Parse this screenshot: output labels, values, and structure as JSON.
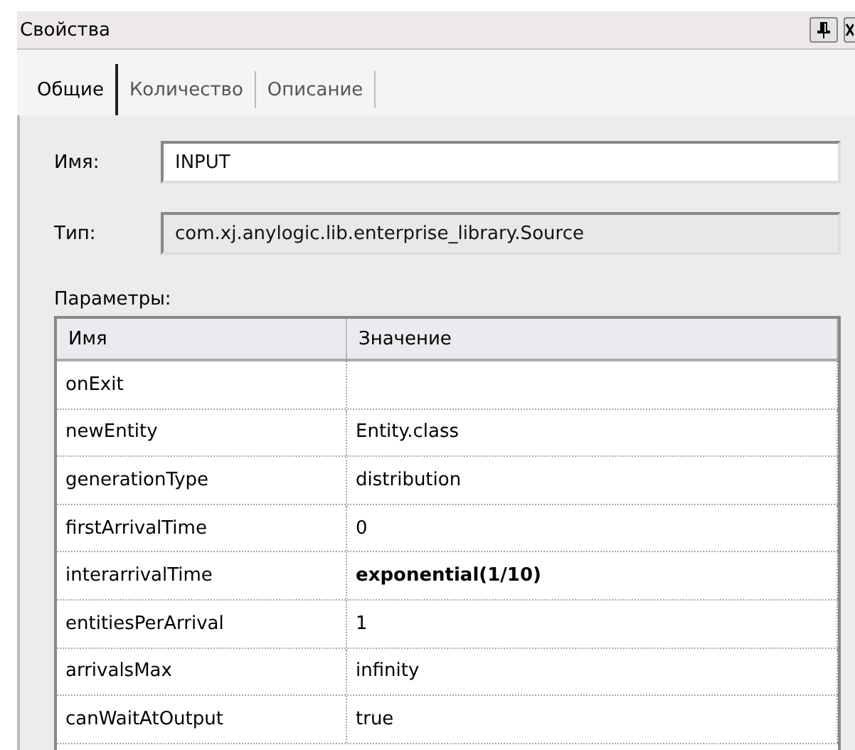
{
  "window": {
    "title": "Свойства"
  },
  "tabs": [
    {
      "label": "Общие",
      "selected": true
    },
    {
      "label": "Количество",
      "selected": false
    },
    {
      "label": "Описание",
      "selected": false
    }
  ],
  "name_field": {
    "label": "Имя:",
    "value": "INPUT"
  },
  "type_field": {
    "label": "Тип:",
    "value": "com.xj.anylogic.lib.enterprise_library.Source",
    "disabled": true
  },
  "parameters": {
    "label": "Параметры:",
    "columns": [
      "Имя",
      "Значение"
    ],
    "rows": [
      {
        "name": "onExit"
      },
      {
        "name": "newEntity",
        "value": "Entity.class",
        "bold": false
      },
      {
        "name": "generationType",
        "value": "distribution",
        "bold": false
      },
      {
        "name": "firstArrivalTime",
        "value": "0",
        "bold": false
      },
      {
        "name": "interarrivalTime",
        "value": "exponential(1/10)",
        "bold": true
      },
      {
        "name": "entitiesPerArrival",
        "value": "1",
        "bold": false
      },
      {
        "name": "arrivalsMax",
        "value": "infinity",
        "bold": false
      },
      {
        "name": "canWaitAtOutput",
        "value": "true",
        "bold": false
      }
    ]
  }
}
